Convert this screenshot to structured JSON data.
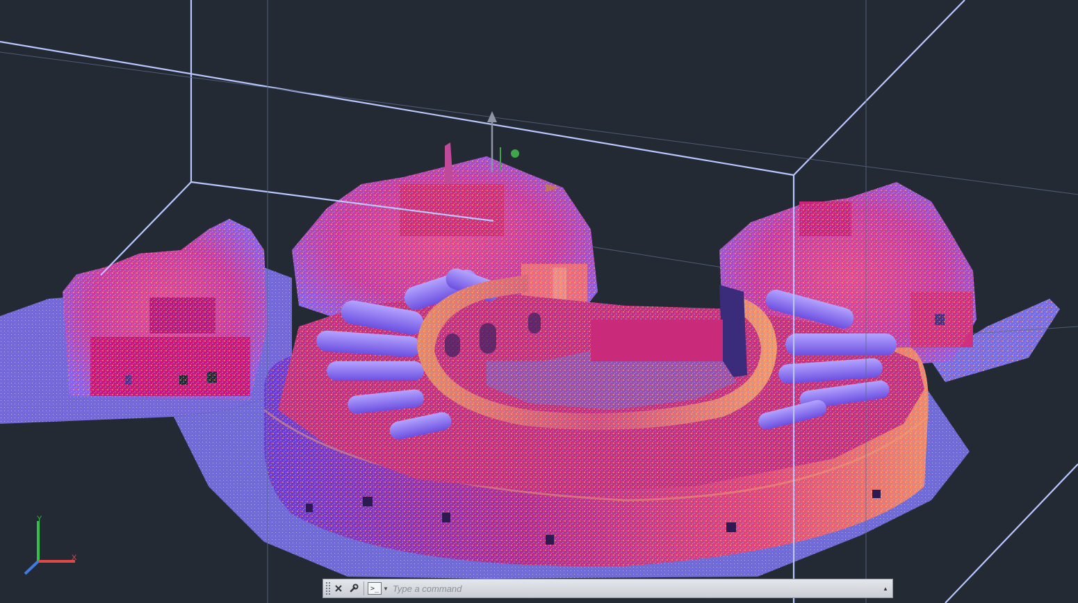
{
  "viewport": {
    "background_color": "#232a33",
    "bounding_box_color": "#b9c7ff",
    "content": "point-cloud-3d-view"
  },
  "ucs_icon": {
    "y_label": "Y",
    "x_label": "X",
    "y_color": "#31c14a",
    "x_color": "#e04848",
    "z_color": "#3f7be0"
  },
  "gizmo": {
    "z_arrow_color": "#8d95a6",
    "green_handle_color": "#3fa64a",
    "orange_handle_color": "#c0765a"
  },
  "command_line": {
    "close_icon": "close-icon",
    "customize_icon": "wrench-icon",
    "prompt_icon": "command-prompt-icon",
    "placeholder": "Type a command",
    "value": ""
  }
}
